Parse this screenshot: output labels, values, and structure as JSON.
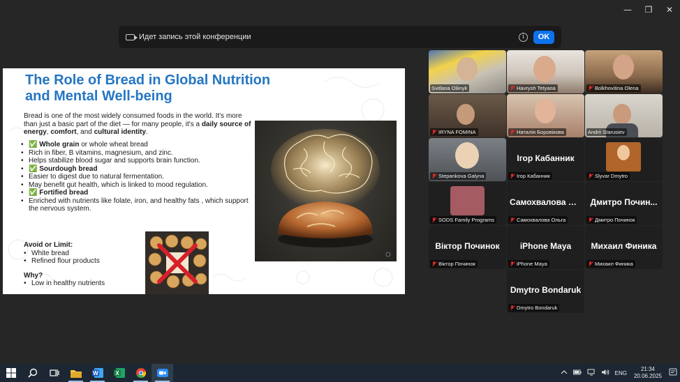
{
  "window": {
    "minimize": "—",
    "restore": "❐",
    "close": "✕"
  },
  "banner": {
    "text": "Идет запись этой конференции",
    "ok_label": "OK",
    "info_glyph": "i"
  },
  "slide": {
    "title": "The Role of Bread in Global Nutrition and Mental Well-being",
    "intro_plain": "Bread is one of the most widely consumed foods in the world. It's more than just a basic part of the diet — for many people, it's a ",
    "intro_bold_1": "daily source of energy",
    "intro_sep_1": ", ",
    "intro_bold_2": "comfort",
    "intro_sep_2": ", and ",
    "intro_bold_3": "cultural identity",
    "intro_end": ".",
    "list": [
      {
        "text": "✅ Whole grain",
        "bold_part": "Whole grain",
        "prefix": "✅ ",
        "rest": " or whole wheat bread"
      },
      {
        "text": "Rich in fiber, B vitamins, magnesium, and zinc."
      },
      {
        "text": "Helps stabilize blood sugar and supports brain function."
      },
      {
        "prefix": "✅ ",
        "bold_part": "Sourdough bread",
        "rest": ""
      },
      {
        "text": "Easier to digest due to natural fermentation."
      },
      {
        "text": "May benefit gut health, which is linked to mood regulation."
      },
      {
        "prefix": "✅ ",
        "bold_part": "Fortified bread",
        "rest": ""
      },
      {
        "text": "Enriched with nutrients like folate, iron, and healthy fats , which support the nervous system."
      }
    ],
    "avoid_heading": "Avoid or Limit:",
    "avoid_items": [
      "White bread",
      "Refined flour products"
    ],
    "why_heading": "Why?",
    "why_items": [
      "Low in healthy nutrients"
    ]
  },
  "participants": [
    {
      "name": "Svitlana Oliinyk",
      "video": true,
      "muted": false,
      "bg": "#7f98b8"
    },
    {
      "name": "Havrysh Tetyana",
      "video": true,
      "muted": true,
      "bg": "#b39c8a"
    },
    {
      "name": "Bolkhovitina Olena",
      "video": true,
      "muted": true,
      "bg": "#7a5e48"
    },
    {
      "name": "IRYNA FOMINA",
      "video": true,
      "muted": true,
      "bg": "#4b4037"
    },
    {
      "name": "Наталія Боровікова",
      "video": true,
      "muted": true,
      "bg": "#b08870"
    },
    {
      "name": "Andrii Starusiev",
      "video": true,
      "muted": false,
      "bg": "#cfcbc2",
      "active": true
    },
    {
      "name": "Stepankova Galyna",
      "video": true,
      "muted": true,
      "bg": "#5f6468"
    },
    {
      "name": "Ігор Кабанник",
      "display": "Ігор Кабанник",
      "video": false,
      "muted": true
    },
    {
      "name": "Slyvar Dmytro",
      "video": true,
      "muted": true,
      "bg": "#2a2622"
    },
    {
      "name": "SODS Family Programs",
      "video": false,
      "avatar": true,
      "muted": true
    },
    {
      "name": "Самохвалова Ольга",
      "display": "Самохвалова О...",
      "video": false,
      "muted": true
    },
    {
      "name": "Дмитро Починок",
      "display": "Дмитро Почин...",
      "video": false,
      "muted": true
    },
    {
      "name": "Віктор Починок",
      "display": "Віктор Починок",
      "video": false,
      "muted": true
    },
    {
      "name": "iPhone Maya",
      "display": "iPhone Maya",
      "video": false,
      "muted": true
    },
    {
      "name": "Михаил Финика",
      "display": "Михаил Финика",
      "video": false,
      "muted": true
    },
    {
      "name": "Dmytro Bondaruk",
      "display": "Dmytro Bondaruk",
      "video": false,
      "muted": true
    }
  ],
  "taskbar": {
    "apps": [
      {
        "name": "windows-start",
        "color": "#ffffff"
      },
      {
        "name": "search",
        "color": "#ffffff"
      },
      {
        "name": "task-view",
        "color": "#ffffff"
      },
      {
        "name": "file-explorer",
        "color": "#f4c542"
      },
      {
        "name": "word",
        "color": "#2b5fb3"
      },
      {
        "name": "excel",
        "color": "#1e7145"
      },
      {
        "name": "chrome",
        "color": "#e84436"
      },
      {
        "name": "zoom",
        "color": "#2d8cff"
      }
    ],
    "lang": "ENG",
    "time": "21:34",
    "date": "20.06.2025"
  }
}
